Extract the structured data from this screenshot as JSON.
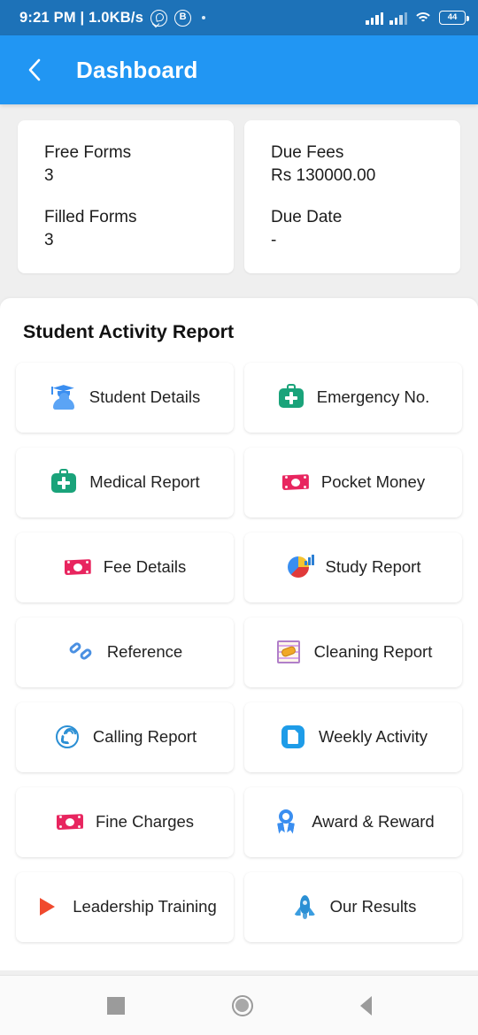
{
  "status_bar": {
    "time_and_speed": "9:21 PM | 1.0KB/s",
    "whatsapp_icon": "whatsapp-icon",
    "b_icon_label": "B",
    "battery_percent": "44",
    "wifi_icon": "wifi-icon",
    "signal_icon": "signal-bars-icon"
  },
  "appbar": {
    "back_icon": "chevron-left-icon",
    "title": "Dashboard"
  },
  "summary": {
    "free_forms_label": "Free Forms",
    "free_forms_value": "3",
    "filled_forms_label": "Filled Forms",
    "filled_forms_value": "3",
    "due_fees_label": "Due Fees",
    "due_fees_value": "Rs 130000.00",
    "due_date_label": "Due Date",
    "due_date_value": "-"
  },
  "panel": {
    "title": "Student Activity Report",
    "tiles": [
      {
        "label": "Student Details",
        "icon": "graduate-icon"
      },
      {
        "label": "Emergency No.",
        "icon": "medical-bag-icon"
      },
      {
        "label": "Medical Report",
        "icon": "medical-bag-icon"
      },
      {
        "label": "Pocket Money",
        "icon": "banknote-icon"
      },
      {
        "label": "Fee Details",
        "icon": "banknote-icon"
      },
      {
        "label": "Study Report",
        "icon": "pie-chart-icon"
      },
      {
        "label": "Reference",
        "icon": "link-icon"
      },
      {
        "label": "Cleaning Report",
        "icon": "cleaning-notepad-icon"
      },
      {
        "label": "Calling Report",
        "icon": "phone-call-icon"
      },
      {
        "label": "Weekly Activity",
        "icon": "book-icon"
      },
      {
        "label": "Fine Charges",
        "icon": "banknote-icon"
      },
      {
        "label": "Award & Reward",
        "icon": "award-ribbon-icon"
      },
      {
        "label": "Leadership Training",
        "icon": "play-triangle-icon"
      },
      {
        "label": "Our Results",
        "icon": "rocket-icon"
      }
    ]
  },
  "navbar": {
    "recents_icon": "recents-square-icon",
    "home_icon": "home-circle-icon",
    "back_icon": "back-triangle-icon"
  },
  "colors": {
    "status_bar": "#1d72b8",
    "app_bar": "#2196f3",
    "page_background": "#efefef",
    "card": "#ffffff",
    "accent_teal": "#1aa37a",
    "accent_pink": "#e8255f",
    "accent_blue": "#3a8ef0",
    "accent_red": "#f04a2e"
  }
}
